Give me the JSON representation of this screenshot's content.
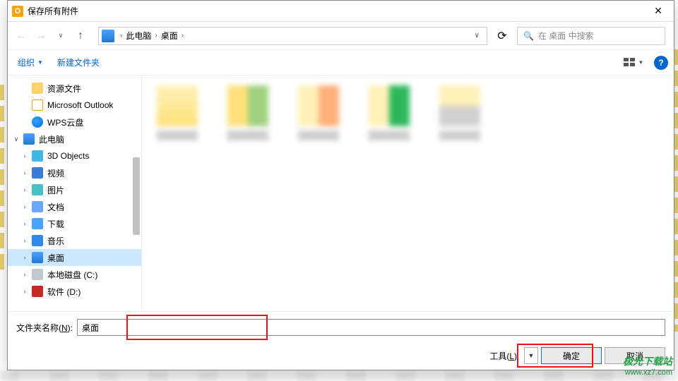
{
  "title": "保存所有附件",
  "nav": {
    "crumb1": "此电脑",
    "crumb2": "桌面"
  },
  "search": {
    "placeholder": "在 桌面 中搜索"
  },
  "toolbar": {
    "organize": "组织",
    "newfolder": "新建文件夹"
  },
  "sidebar": {
    "items": [
      {
        "label": "资源文件",
        "icon": "ic-folder",
        "indent": 1,
        "expand": ""
      },
      {
        "label": "Microsoft Outlook",
        "icon": "ic-outlook",
        "indent": 1,
        "expand": ""
      },
      {
        "label": "WPS云盘",
        "icon": "ic-wps",
        "indent": 1,
        "expand": ""
      },
      {
        "label": "此电脑",
        "icon": "ic-pc",
        "indent": 0,
        "expand": "∨"
      },
      {
        "label": "3D Objects",
        "icon": "ic-3d",
        "indent": 1,
        "expand": "›"
      },
      {
        "label": "视频",
        "icon": "ic-video",
        "indent": 1,
        "expand": "›"
      },
      {
        "label": "图片",
        "icon": "ic-pics",
        "indent": 1,
        "expand": "›"
      },
      {
        "label": "文档",
        "icon": "ic-docs",
        "indent": 1,
        "expand": "›"
      },
      {
        "label": "下载",
        "icon": "ic-down",
        "indent": 1,
        "expand": "›"
      },
      {
        "label": "音乐",
        "icon": "ic-music",
        "indent": 1,
        "expand": "›"
      },
      {
        "label": "桌面",
        "icon": "ic-desk",
        "indent": 1,
        "expand": "›",
        "selected": true
      },
      {
        "label": "本地磁盘 (C:)",
        "icon": "ic-disk",
        "indent": 1,
        "expand": "›"
      },
      {
        "label": "软件 (D:)",
        "icon": "ic-soft",
        "indent": 1,
        "expand": "›"
      }
    ]
  },
  "folder": {
    "label_pre": "文件夹名称(",
    "label_key": "N",
    "label_post": "):",
    "value": "桌面"
  },
  "buttons": {
    "tools_pre": "工具(",
    "tools_key": "L",
    "tools_post": ")",
    "ok": "确定",
    "cancel": "取消"
  },
  "watermark": {
    "line1": "极光下载站",
    "line2": "www.xz7.com"
  }
}
